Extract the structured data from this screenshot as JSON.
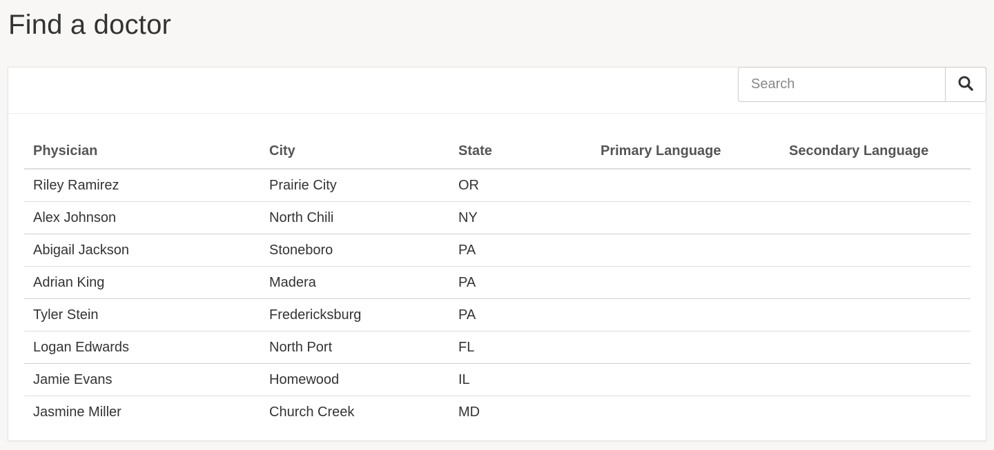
{
  "page": {
    "title": "Find a doctor"
  },
  "search": {
    "placeholder": "Search",
    "value": "",
    "button_icon": "search-icon"
  },
  "table": {
    "columns": [
      "Physician",
      "City",
      "State",
      "Primary Language",
      "Secondary Language"
    ],
    "rows": [
      [
        "Riley Ramirez",
        "Prairie City",
        "OR",
        "",
        ""
      ],
      [
        "Alex Johnson",
        "North Chili",
        "NY",
        "",
        ""
      ],
      [
        "Abigail Jackson",
        "Stoneboro",
        "PA",
        "",
        ""
      ],
      [
        "Adrian King",
        "Madera",
        "PA",
        "",
        ""
      ],
      [
        "Tyler Stein",
        "Fredericksburg",
        "PA",
        "",
        ""
      ],
      [
        "Logan Edwards",
        "North Port",
        "FL",
        "",
        ""
      ],
      [
        "Jamie Evans",
        "Homewood",
        "IL",
        "",
        ""
      ],
      [
        "Jasmine Miller",
        "Church Creek",
        "MD",
        "",
        ""
      ]
    ]
  },
  "colors": {
    "background": "#f8f7f5",
    "panel": "#ffffff",
    "text": "#333333",
    "header_text": "#555555",
    "border": "#dddddd"
  }
}
